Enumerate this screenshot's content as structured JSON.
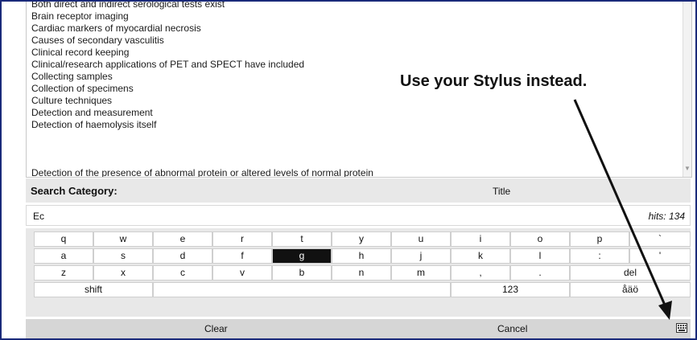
{
  "results": {
    "items": [
      "Both direct and indirect serological tests exist",
      "Brain receptor imaging",
      "Cardiac markers of myocardial necrosis",
      "Causes of secondary vasculitis",
      "Clinical record keeping",
      "Clinical/research applications of PET and SPECT have included",
      "Collecting samples",
      "Collection of specimens",
      "Culture techniques",
      "Detection and measurement",
      "Detection of haemolysis itself",
      "Detection of the presence of abnormal protein or altered levels of normal protein"
    ]
  },
  "annotation": {
    "text": "Use your Stylus instead."
  },
  "search": {
    "label": "Search Category:",
    "category": "Title",
    "input_value": "Ec",
    "hits": "hits: 134"
  },
  "keyboard": {
    "row1": [
      "q",
      "w",
      "e",
      "r",
      "t",
      "y",
      "u",
      "i",
      "o",
      "p",
      "`"
    ],
    "row2": [
      "a",
      "s",
      "d",
      "f",
      "g",
      "h",
      "j",
      "k",
      "l",
      ":",
      "'"
    ],
    "row3": [
      "z",
      "x",
      "c",
      "v",
      "b",
      "n",
      "m",
      ",",
      ".",
      "del"
    ],
    "row4": [
      "shift",
      "",
      "123",
      "åäö"
    ],
    "active_key": "g"
  },
  "bottom": {
    "clear": "Clear",
    "cancel": "Cancel",
    "icon": "keyboard-icon"
  },
  "colors": {
    "frame_border": "#1a2a7a",
    "panel_gray": "#e8e8e8",
    "active_key": "#111111"
  }
}
